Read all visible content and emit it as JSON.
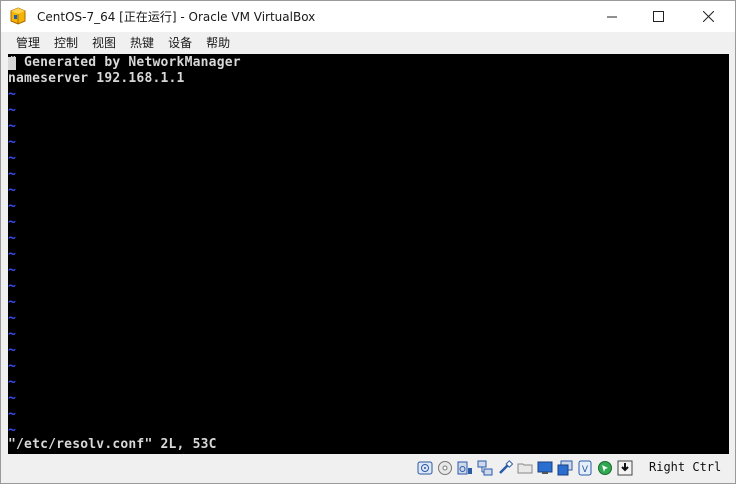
{
  "window": {
    "title": "CentOS-7_64 [正在运行] - Oracle VM VirtualBox",
    "icon": "virtualbox-icon"
  },
  "controls": {
    "minimize_icon": "minimize-icon",
    "maximize_icon": "maximize-icon",
    "close_icon": "close-icon"
  },
  "menu": {
    "items": [
      "管理",
      "控制",
      "视图",
      "热键",
      "设备",
      "帮助"
    ]
  },
  "console": {
    "lines": [
      "# Generated by NetworkManager",
      "nameserver 192.168.1.1"
    ],
    "tilde": "~",
    "status": "\"/etc/resolv.conf\" 2L, 53C"
  },
  "statusbar": {
    "icons": [
      "hard-disk-icon",
      "optical-drive-icon",
      "audio-icon",
      "network-icon",
      "usb-icon",
      "shared-folders-icon",
      "display-icon",
      "video-capture-icon",
      "virtualization-icon",
      "mouse-integration-icon",
      "keyboard-capture-icon"
    ],
    "host_key": "Right Ctrl"
  },
  "colors": {
    "console_bg": "#000000",
    "console_fg": "#d8d8d8",
    "tilde": "#3a4cff",
    "chrome": "#f0f0f0"
  }
}
